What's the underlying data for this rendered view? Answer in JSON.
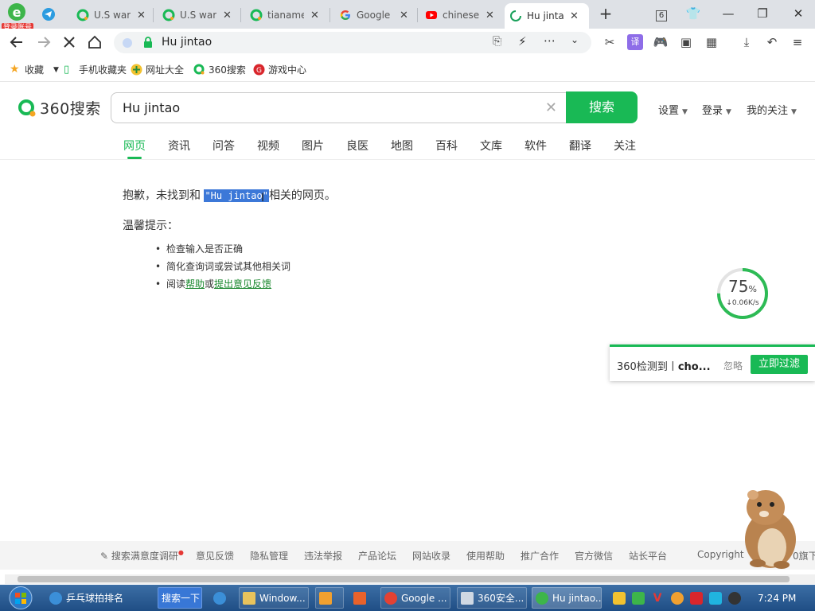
{
  "browser": {
    "login_badge": "登录账号",
    "tabs": [
      {
        "title": "U.S warc",
        "icon": "360-search-icon"
      },
      {
        "title": "U.S warc",
        "icon": "360-search-icon"
      },
      {
        "title": "tianamer",
        "icon": "360-search-icon"
      },
      {
        "title": "Google",
        "icon": "google-icon"
      },
      {
        "title": "chinese c",
        "icon": "youtube-icon"
      },
      {
        "title": "Hu jintao",
        "icon": "loading-spinner-icon",
        "active": true
      }
    ],
    "tab_count": "6",
    "address": "Hu jintao",
    "bookmarks": [
      "收藏",
      "手机收藏夹",
      "网址大全",
      "360搜索",
      "游戏中心"
    ]
  },
  "search": {
    "logo_text": "360搜索",
    "query": "Hu jintao",
    "button": "搜索",
    "top_links": [
      "设置",
      "登录",
      "我的关注"
    ],
    "tabs": [
      "网页",
      "资讯",
      "问答",
      "视频",
      "图片",
      "良医",
      "地图",
      "百科",
      "文库",
      "软件",
      "翻译",
      "关注"
    ]
  },
  "result": {
    "prefix": "抱歉，未找到和",
    "quoted": "\"Hu jintao\"",
    "suffix": "相关的网页。",
    "tip_title": "温馨提示：",
    "tips": [
      "检查输入是否正确",
      "简化查询词或尝试其他相关词"
    ],
    "tip3": {
      "pre": "阅读",
      "help": "帮助",
      "mid": "或",
      "feedback": "提出意见反馈"
    }
  },
  "speed_widget": {
    "percent": "75",
    "percent_sign": "%",
    "rate": "↓0.06K/s",
    "progress": 0.75
  },
  "notification": {
    "text": "360检测到丨",
    "bold": "cho...",
    "ignore": "忽略",
    "action": "立即过滤"
  },
  "footer": {
    "links": [
      "搜索满意度调研",
      "意见反馈",
      "隐私管理",
      "违法举报",
      "产品论坛",
      "网站收录",
      "使用帮助",
      "推广合作",
      "官方微信",
      "站长平台"
    ],
    "copyright": "Copyright",
    "copyright_tail": "0旗下"
  },
  "taskbar": {
    "items": [
      "乒乓球拍排名",
      "搜索一下",
      "Window...",
      "Google ...",
      "360安全...",
      "Hu jintao..."
    ],
    "time": "7:24 PM"
  },
  "colors": {
    "accent": "#19b955",
    "selection": "#3c78d8",
    "taskbar": "#2a5c95"
  }
}
